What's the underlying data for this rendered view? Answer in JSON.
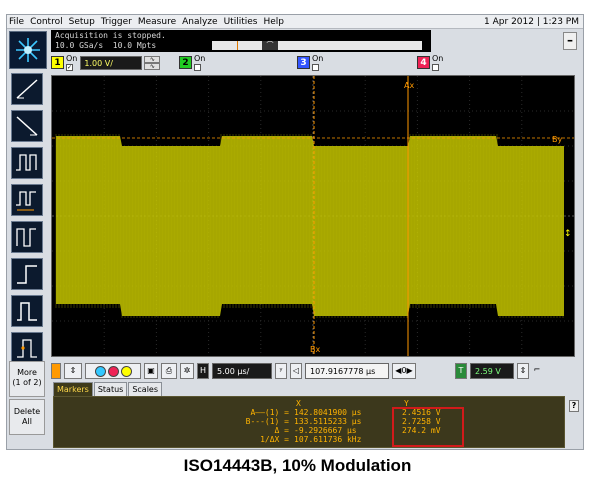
{
  "menu": {
    "items": [
      "File",
      "Control",
      "Setup",
      "Trigger",
      "Measure",
      "Analyze",
      "Utilities",
      "Help"
    ],
    "datetime": "1 Apr 2012 | 1:23 PM"
  },
  "acquisition": {
    "status_line": "Acquisition is stopped.",
    "rate_line": "10.0 GSa/s  10.0 Mpts"
  },
  "channels": [
    {
      "number": "1",
      "on_label": "On",
      "checked": true,
      "scale": "1.00 V/",
      "color": "#ffff00"
    },
    {
      "number": "2",
      "on_label": "On",
      "checked": false,
      "color": "#22cc22"
    },
    {
      "number": "3",
      "on_label": "On",
      "checked": false,
      "color": "#3355ff"
    },
    {
      "number": "4",
      "on_label": "On",
      "checked": false,
      "color": "#ee2255"
    }
  ],
  "sidebar": {
    "more_label_line1": "More",
    "more_label_line2": "(1 of 2)",
    "delete_label_line1": "Delete",
    "delete_label_line2": "All"
  },
  "screen": {
    "marker_a": "Ax",
    "marker_b": "Bx",
    "marker_by": "By",
    "waveform_color": "#c8c800",
    "marker_color": "#ff9900"
  },
  "controls": {
    "timebase": "5.00 μs/",
    "delay": "107.9167778 μs",
    "trigger_level": "2.59 V",
    "trigger_label": "T"
  },
  "tabs": [
    "Markers",
    "Status",
    "Scales"
  ],
  "markers": {
    "header_x": "X",
    "header_y": "Y",
    "rows": [
      {
        "label": "A——(1) =",
        "x": "142.8041900 μs",
        "y": "2.4516 V"
      },
      {
        "label": "B---(1) =",
        "x": "133.5115233 μs",
        "y": "2.7258 V"
      },
      {
        "label": "Δ =",
        "x": "-9.2926667 μs",
        "y": "274.2 mV"
      },
      {
        "label": "1/ΔX =",
        "x": "107.611736 kHz",
        "y": ""
      }
    ]
  },
  "caption": "ISO14443B, 10% Modulation"
}
